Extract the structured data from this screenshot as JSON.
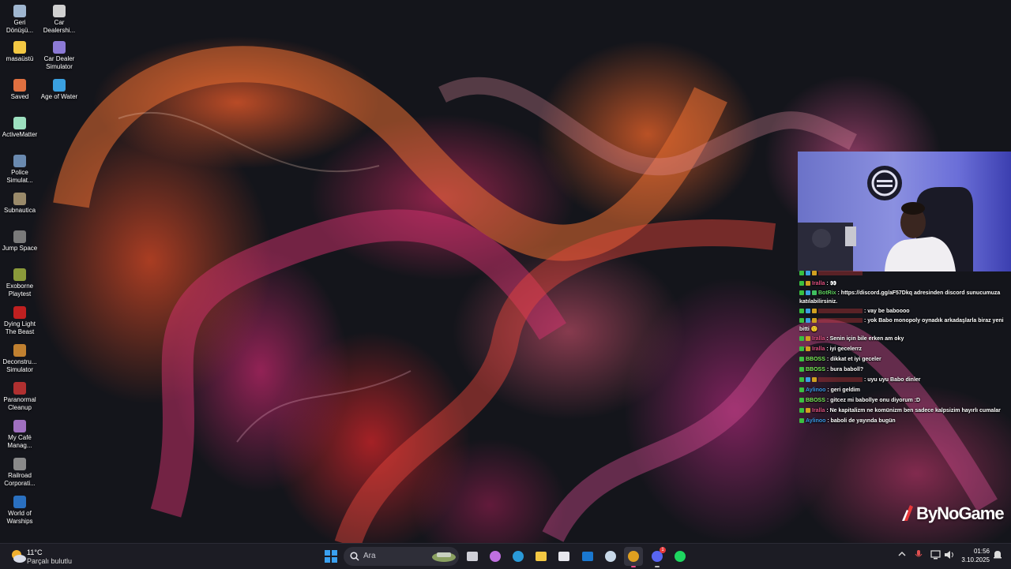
{
  "desktop_icons": [
    {
      "label": "Geri Dönüşü...",
      "icon": "recycle-bin-icon",
      "color": "#9fb6d0"
    },
    {
      "label": "Car Dealershi...",
      "icon": "car-dealership-icon",
      "color": "#d0d0d0"
    },
    {
      "label": "masaüstü",
      "icon": "folder-icon",
      "color": "#f3c843"
    },
    {
      "label": "Car Dealer Simulator",
      "icon": "car-dealer-simulator-icon",
      "color": "#8c7ad6"
    },
    {
      "label": "Saved",
      "icon": "saved-game-icon",
      "color": "#e07040"
    },
    {
      "label": "Age of Water",
      "icon": "age-of-water-icon",
      "color": "#3aa0e0"
    },
    {
      "label": "ActiveMatter",
      "icon": "activematter-icon",
      "color": "#9de0c0"
    },
    {
      "label": "Police Simulat...",
      "icon": "police-simulator-icon",
      "color": "#6a8ab0"
    },
    {
      "label": "Subnautica",
      "icon": "subnautica-icon",
      "color": "#9a8a6a"
    },
    {
      "label": "Jump Space",
      "icon": "jump-space-icon",
      "color": "#7a7a7a"
    },
    {
      "label": "Exoborne Playtest",
      "icon": "exoborne-icon",
      "color": "#8a9a3a"
    },
    {
      "label": "Dying Light The Beast",
      "icon": "dying-light-icon",
      "color": "#c02020"
    },
    {
      "label": "Deconstru... Simulator",
      "icon": "deconstruction-simulator-icon",
      "color": "#c08030"
    },
    {
      "label": "Paranormal Cleanup",
      "icon": "paranormal-cleanup-icon",
      "color": "#b03030"
    },
    {
      "label": "My Café Manag...",
      "icon": "my-cafe-manager-icon",
      "color": "#a070c0"
    },
    {
      "label": "Railroad Corporati...",
      "icon": "railroad-corporation-icon",
      "color": "#8a8a8a"
    },
    {
      "label": "World of Warships",
      "icon": "world-of-warships-icon",
      "color": "#2a70c0"
    }
  ],
  "chat": [
    {
      "user": "",
      "user_color": "#e04040",
      "text": "",
      "badges": [
        "#3ac040",
        "#3aa0e0",
        "#d0a020"
      ]
    },
    {
      "user": "Iralla",
      "user_color": "#e05080",
      "text": ": 👀",
      "badges": [
        "#3ac040",
        "#d0a020"
      ]
    },
    {
      "user": "BotRix",
      "user_color": "#5fd35f",
      "text": ": https://discord.gg/aF57Dkq adresinden discord sunucumuza katılabilirsiniz.",
      "badges": [
        "#3ac040",
        "#3aa0e0",
        "#40c060"
      ]
    },
    {
      "user": "",
      "user_color": "#e04040",
      "text": ": vay be baboooo",
      "badges": [
        "#3ac040",
        "#3aa0e0",
        "#d0a020"
      ]
    },
    {
      "user": "",
      "user_color": "#e04040",
      "text": ": yok Babo monopoly oynadık arkadaşlarla biraz yeni bitti 🙂",
      "badges": [
        "#3ac040",
        "#3aa0e0",
        "#d0a020"
      ]
    },
    {
      "user": "Iralla",
      "user_color": "#e05080",
      "text": ": Senin için bile erken am oky",
      "badges": [
        "#3ac040",
        "#d0a020"
      ]
    },
    {
      "user": "Iralla",
      "user_color": "#e05080",
      "text": ": iyi gecelerrz",
      "badges": [
        "#3ac040",
        "#d0a020"
      ]
    },
    {
      "user": "BBOSS",
      "user_color": "#7cf05c",
      "text": ": dikkat et iyi geceler",
      "badges": [
        "#3ac040"
      ]
    },
    {
      "user": "BBOSS",
      "user_color": "#7cf05c",
      "text": ": bura baboll?",
      "badges": [
        "#3ac040"
      ]
    },
    {
      "user": "",
      "user_color": "#e04040",
      "text": ": uyu uyu Babo dinler",
      "badges": [
        "#3ac040",
        "#3aa0e0",
        "#d0a020"
      ]
    },
    {
      "user": "Aylinoo",
      "user_color": "#3a9ae8",
      "text": ": geri geldim",
      "badges": [
        "#3ac040"
      ]
    },
    {
      "user": "BBOSS",
      "user_color": "#7cf05c",
      "text": ": gitcez mi babollye onu diyorum :D",
      "badges": [
        "#3ac040"
      ]
    },
    {
      "user": "Iralla",
      "user_color": "#e05080",
      "text": ": Ne kapitalizm ne komünizm ben sadece kalpsizim hayırlı cumalar",
      "badges": [
        "#3ac040",
        "#d0a020"
      ]
    },
    {
      "user": "Aylinoo",
      "user_color": "#3a9ae8",
      "text": ": baboli de yayında bugün",
      "badges": [
        "#3ac040"
      ]
    }
  ],
  "overlay": {
    "brand": "ByNoGame"
  },
  "taskbar": {
    "weather_temp": "11°C",
    "weather_desc": "Parçalı bulutlu",
    "search_placeholder": "Ara",
    "clock_time": "01:56",
    "clock_date": "3.10.2025",
    "discord_badge": "1",
    "apps": [
      {
        "name": "start-button",
        "icon": "windows-logo-icon",
        "color": "#3aa0f0"
      },
      {
        "name": "task-view-button",
        "icon": "task-view-icon",
        "color": "#d0d0d8"
      },
      {
        "name": "copilot-button",
        "icon": "copilot-icon",
        "color": "#c070e0"
      },
      {
        "name": "edge-button",
        "icon": "edge-icon",
        "color": "#2a9ad8"
      },
      {
        "name": "file-explorer-button",
        "icon": "folder-icon",
        "color": "#f3c843"
      },
      {
        "name": "store-button",
        "icon": "store-icon",
        "color": "#e8e8ee"
      },
      {
        "name": "outlook-button",
        "icon": "outlook-icon",
        "color": "#1a78d0"
      },
      {
        "name": "steam-button",
        "icon": "steam-icon",
        "color": "#c8d8e8"
      },
      {
        "name": "chrome-button",
        "icon": "chrome-icon",
        "color": "#e0a020"
      },
      {
        "name": "discord-button",
        "icon": "discord-icon",
        "color": "#5865f2"
      },
      {
        "name": "spotify-button",
        "icon": "spotify-icon",
        "color": "#1ed760"
      }
    ]
  }
}
